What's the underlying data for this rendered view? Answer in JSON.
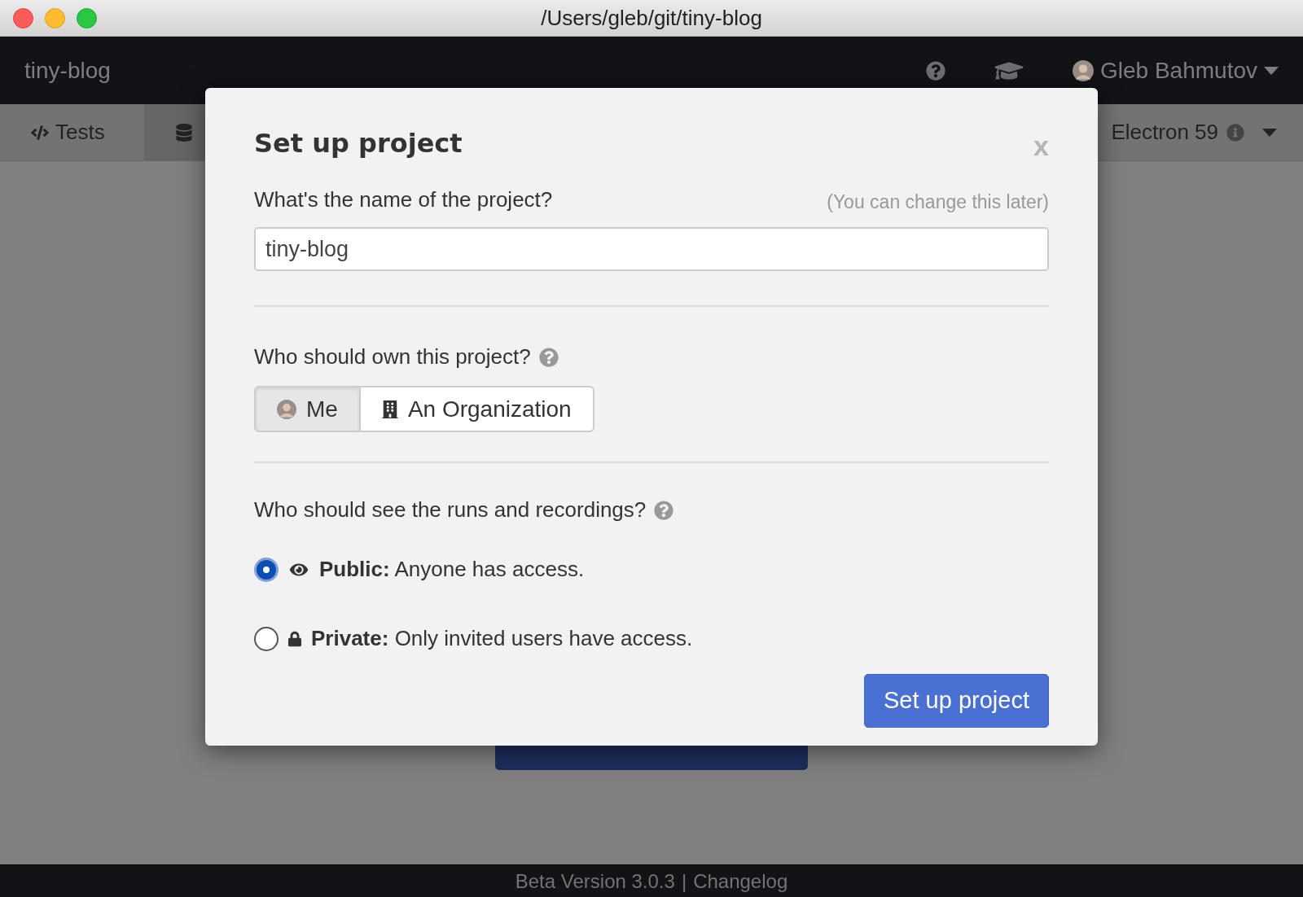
{
  "window": {
    "title": "/Users/gleb/git/tiny-blog"
  },
  "navbar": {
    "brand": "tiny-blog",
    "user": "Gleb Bahmutov"
  },
  "tabs": [
    {
      "label": "Tests",
      "kind": "code",
      "selected": false
    },
    {
      "kind": "database",
      "selected": true
    }
  ],
  "browser": {
    "label": "Electron 59"
  },
  "background_button": {
    "kind": "record"
  },
  "footer": {
    "version": "Beta Version 3.0.3",
    "separator": "|",
    "link": "Changelog"
  },
  "modal": {
    "title": "Set up project",
    "close": "x",
    "name_label": "What's the name of the project?",
    "name_hint": "(You can change this later)",
    "name_value": "tiny-blog",
    "owner_label": "Who should own this project?",
    "owners": [
      {
        "label": "Me",
        "kind": "avatar",
        "selected": true
      },
      {
        "label": "An Organization",
        "kind": "building",
        "selected": false
      }
    ],
    "visibility_label": "Who should see the runs and recordings?",
    "visibility_options": [
      {
        "label": "Public:",
        "description": "Anyone has access.",
        "kind": "eye",
        "selected": true
      },
      {
        "label": "Private:",
        "description": "Only invited users have access.",
        "kind": "lock",
        "selected": false
      }
    ],
    "submit": "Set up project"
  }
}
